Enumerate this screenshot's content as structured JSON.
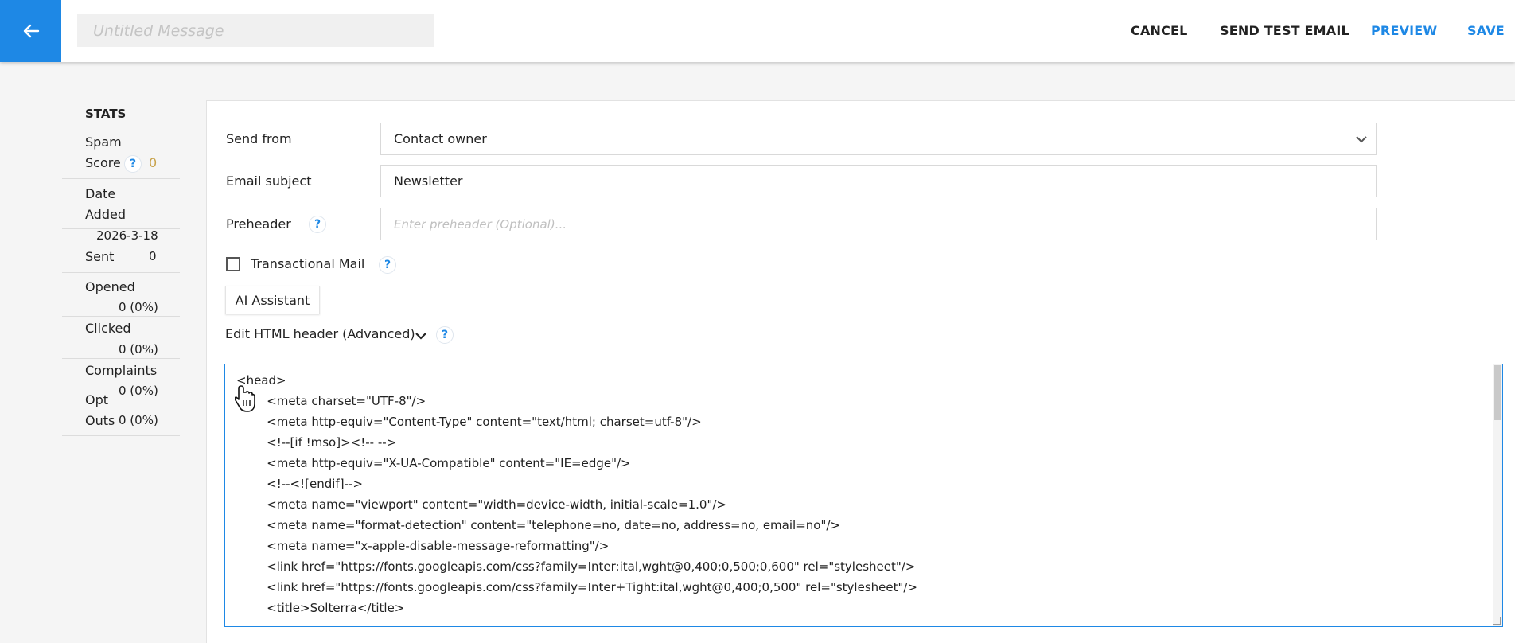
{
  "header": {
    "title_placeholder": "Untitled Message",
    "actions": {
      "cancel": "CANCEL",
      "send_test": "SEND TEST EMAIL",
      "preview": "PREVIEW",
      "save": "SAVE"
    },
    "accent_color": "#1e88e5"
  },
  "stats": {
    "title": "STATS",
    "spam_label_1": "Spam",
    "spam_label_2": "Score",
    "spam_help": "?",
    "spam_value": "0",
    "date_label_1": "Date",
    "date_label_2": "Added",
    "date_value": "2026-3-18",
    "sent_label": "Sent",
    "sent_value": "0",
    "opened_label": "Opened",
    "opened_value": "0 (0%)",
    "clicked_label": "Clicked",
    "clicked_value": "0 (0%)",
    "complaints_label": "Complaints",
    "complaints_value": "0 (0%)",
    "optouts_label_1": "Opt",
    "optouts_label_2": "Outs",
    "optouts_value": "0 (0%)"
  },
  "form": {
    "send_from_label": "Send from",
    "send_from_value": "Contact owner",
    "subject_label": "Email subject",
    "subject_value": "Newsletter",
    "preheader_label": "Preheader",
    "preheader_placeholder": "Enter preheader (Optional)...",
    "help": "?",
    "transactional_label": "Transactional Mail",
    "transactional_checked": false,
    "ai_button": "AI Assistant",
    "edit_header_label": "Edit HTML header (Advanced)"
  },
  "editor": {
    "lines": [
      "<head>",
      "        <meta charset=\"UTF-8\"/>",
      "        <meta http-equiv=\"Content-Type\" content=\"text/html; charset=utf-8\"/>",
      "        <!--[if !mso]><!-- -->",
      "        <meta http-equiv=\"X-UA-Compatible\" content=\"IE=edge\"/>",
      "        <!--<![endif]-->",
      "        <meta name=\"viewport\" content=\"width=device-width, initial-scale=1.0\"/>",
      "        <meta name=\"format-detection\" content=\"telephone=no, date=no, address=no, email=no\"/>",
      "        <meta name=\"x-apple-disable-message-reformatting\"/>",
      "        <link href=\"https://fonts.googleapis.com/css?family=Inter:ital,wght@0,400;0,500;0,600\" rel=\"stylesheet\"/>",
      "        <link href=\"https://fonts.googleapis.com/css?family=Inter+Tight:ital,wght@0,400;0,500\" rel=\"stylesheet\"/>",
      "        <title>Solterra</title>"
    ]
  }
}
